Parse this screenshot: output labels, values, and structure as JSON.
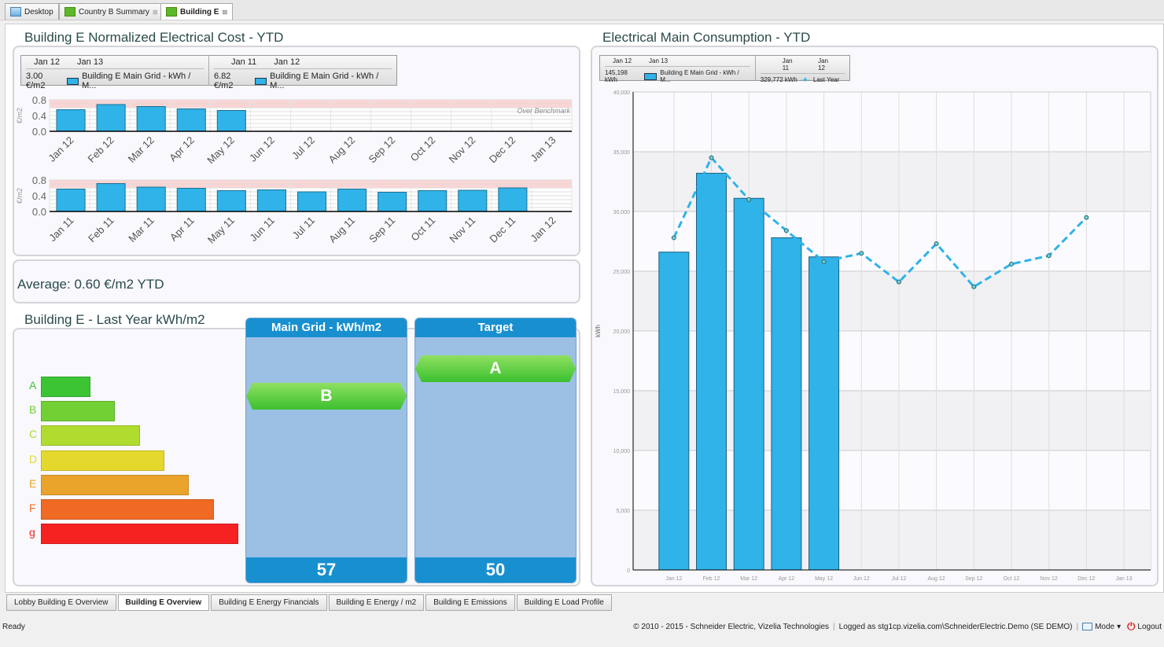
{
  "top_tabs": [
    {
      "label": "Desktop",
      "icon": "desktop-icon"
    },
    {
      "label": "Country B Summary",
      "icon": "dashboard-icon",
      "closable": true
    },
    {
      "label": "Building E",
      "icon": "chart-icon",
      "closable": true,
      "active": true
    }
  ],
  "cost_panel": {
    "title": "Building E Normalized Electrical Cost - YTD",
    "legend": [
      {
        "from": "Jan 12",
        "to": "Jan 13",
        "value": "3.00 €/m2",
        "series": "Building E Main Grid - kWh / M..."
      },
      {
        "from": "Jan 11",
        "to": "Jan 12",
        "value": "6.82 €/m2",
        "series": "Building E Main Grid - kWh / M..."
      }
    ],
    "benchmark_label": "Over Benchmark"
  },
  "average": {
    "text": "Average: 0.60 €/m2 YTD"
  },
  "rating_panel": {
    "title": "Building E -  Last Year kWh/m2",
    "classes": [
      {
        "label": "A",
        "color": "#3cc434"
      },
      {
        "label": "B",
        "color": "#72cf34"
      },
      {
        "label": "C",
        "color": "#b0dc30"
      },
      {
        "label": "D",
        "color": "#e4d82c"
      },
      {
        "label": "E",
        "color": "#eaa42c"
      },
      {
        "label": "F",
        "color": "#f06a24"
      },
      {
        "label": "g",
        "color": "#f62222"
      }
    ],
    "main_grid": {
      "header": "Main Grid - kWh/m2",
      "class": "B",
      "value": "57"
    },
    "target": {
      "header": "Target",
      "class": "A",
      "value": "50"
    }
  },
  "consumption_panel": {
    "title": "Electrical Main Consumption - YTD",
    "legend": [
      {
        "from": "Jan 12",
        "to": "Jan 13",
        "value": "145,198 kWh",
        "series": "Building E Main Grid - kWh / M..."
      },
      {
        "from": "Jan 11",
        "to": "Jan 12",
        "value": "329,772 kWh",
        "series": "Last Year"
      }
    ]
  },
  "chart_data": [
    {
      "type": "bar",
      "ylabel": "€/m2",
      "ylim": [
        0,
        0.8
      ],
      "yticks": [
        "0.0",
        "0.4",
        "0.8"
      ],
      "benchmark_band": [
        0.6,
        0.8
      ],
      "color": "#2fb3e8",
      "categories": [
        "Jan 12",
        "Feb 12",
        "Mar 12",
        "Apr 12",
        "May 12",
        "Jun 12",
        "Jul 12",
        "Aug 12",
        "Sep 12",
        "Oct 12",
        "Nov 12",
        "Dec 12",
        "Jan 13"
      ],
      "values": [
        0.55,
        0.68,
        0.63,
        0.57,
        0.53,
        null,
        null,
        null,
        null,
        null,
        null,
        null,
        null
      ]
    },
    {
      "type": "bar",
      "ylabel": "€/m2",
      "ylim": [
        0,
        0.8
      ],
      "yticks": [
        "0.0",
        "0.4",
        "0.8"
      ],
      "benchmark_band": [
        0.6,
        0.8
      ],
      "color": "#2fb3e8",
      "categories": [
        "Jan 11",
        "Feb 11",
        "Mar 11",
        "Apr 11",
        "May 11",
        "Jun 11",
        "Jul 11",
        "Aug 11",
        "Sep 11",
        "Oct 11",
        "Nov 11",
        "Dec 11",
        "Jan 12"
      ],
      "values": [
        0.57,
        0.71,
        0.62,
        0.59,
        0.53,
        0.55,
        0.5,
        0.57,
        0.49,
        0.53,
        0.54,
        0.6,
        null
      ]
    },
    {
      "type": "bar+line",
      "ylabel": "kWh",
      "ylim": [
        0,
        40000
      ],
      "yticks": [
        "0",
        "5,000",
        "10,000",
        "15,000",
        "20,000",
        "25,000",
        "30,000",
        "35,000",
        "40,000"
      ],
      "grid": true,
      "categories": [
        "Jan 12",
        "Feb 12",
        "Mar 12",
        "Apr 12",
        "May 12",
        "Jun 12",
        "Jul 12",
        "Aug 12",
        "Sep 12",
        "Oct 12",
        "Nov 12",
        "Dec 12",
        "Jan 13"
      ],
      "series": [
        {
          "name": "Building E Main Grid - kWh / M...",
          "type": "bar",
          "color": "#2fb3e8",
          "values": [
            26600,
            33200,
            31100,
            27800,
            26200,
            null,
            null,
            null,
            null,
            null,
            null,
            null,
            null
          ]
        },
        {
          "name": "Last Year",
          "type": "line",
          "style": "dashed",
          "color": "#2fb3e8",
          "values": [
            27800,
            34500,
            31000,
            28400,
            25800,
            26500,
            24100,
            27300,
            23700,
            25600,
            26300,
            29500,
            null
          ]
        }
      ]
    }
  ],
  "bottom_tabs": [
    "Lobby Building E Overview",
    "Building E Overview",
    "Building E Energy Financials",
    "Building E Energy / m2",
    "Building E Emissions",
    "Building E Load Profile"
  ],
  "bottom_active": 1,
  "status": {
    "left": "Ready",
    "copyright": "© 2010 - 2015 - Schneider Electric, Vizelia Technologies",
    "logged": "Logged as stg1cp.vizelia.com\\SchneiderElectric.Demo (SE DEMO)",
    "mode": "Mode",
    "logout": "Logout"
  }
}
